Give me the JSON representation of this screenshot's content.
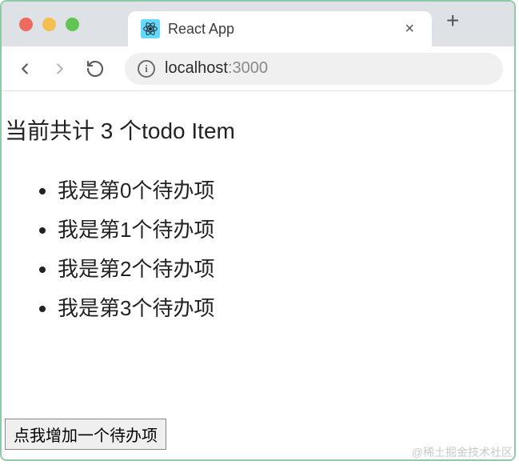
{
  "browser": {
    "tab_title": "React App",
    "url_host": "localhost",
    "url_port": ":3000"
  },
  "page": {
    "heading": "当前共计 3 个todo Item",
    "todos": [
      "我是第0个待办项",
      "我是第1个待办项",
      "我是第2个待办项",
      "我是第3个待办项"
    ],
    "add_button_label": "点我增加一个待办项"
  },
  "watermark": "@稀土掘金技术社区"
}
